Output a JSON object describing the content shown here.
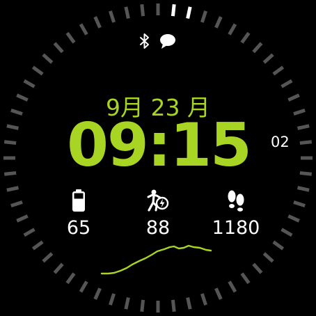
{
  "date": {
    "text": "9月 23 月"
  },
  "time": {
    "hours_minutes": "09:15",
    "seconds": "02"
  },
  "status_icons": [
    "bluetooth-icon",
    "message-icon"
  ],
  "stats": {
    "battery": {
      "icon": "battery-icon",
      "value": "65"
    },
    "activity": {
      "icon": "activity-icon",
      "value": "88"
    },
    "steps": {
      "icon": "footsteps-icon",
      "value": "1180"
    }
  },
  "colors": {
    "accent": "#a8d523",
    "text": "#ffffff",
    "tick_inactive": "#555555",
    "tick_active": "#ffffff",
    "background": "#000000"
  },
  "seconds_progress": 0.033
}
